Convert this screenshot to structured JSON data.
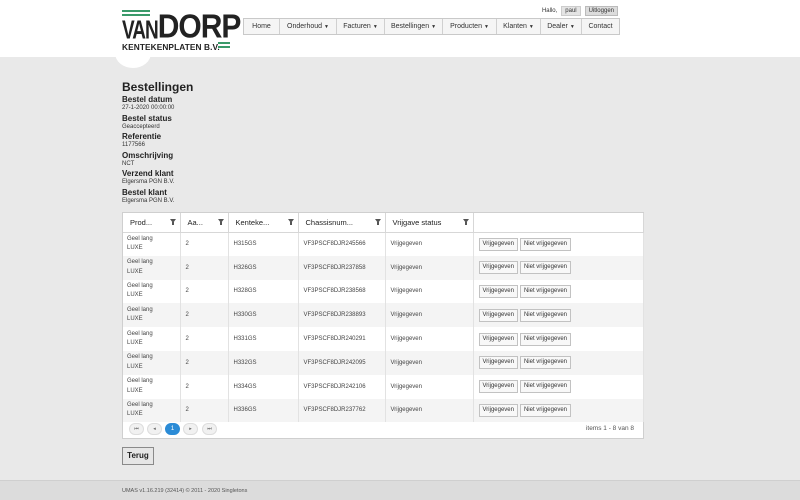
{
  "logo": {
    "top": "VAN DORP",
    "van": "VAN",
    "dorp": "DORP",
    "sub": "KENTEKENPLATEN B.V.",
    "accent": "#3a9a6a"
  },
  "user": {
    "greeting": "Hallo,",
    "name": "paul",
    "logout": "Uitloggen"
  },
  "nav": [
    {
      "label": "Home",
      "dropdown": false
    },
    {
      "label": "Onderhoud",
      "dropdown": true
    },
    {
      "label": "Facturen",
      "dropdown": true
    },
    {
      "label": "Bestellingen",
      "dropdown": true
    },
    {
      "label": "Producten",
      "dropdown": true
    },
    {
      "label": "Klanten",
      "dropdown": true
    },
    {
      "label": "Dealer",
      "dropdown": true
    },
    {
      "label": "Contact",
      "dropdown": false
    }
  ],
  "page": {
    "title": "Bestellingen"
  },
  "details": [
    {
      "label": "Bestel datum",
      "value": "27-1-2020 00:00:00"
    },
    {
      "label": "Bestel status",
      "value": "Geaccepteerd"
    },
    {
      "label": "Referentie",
      "value": "1177566"
    },
    {
      "label": "Omschrijving",
      "value": "NCT"
    },
    {
      "label": "Verzend klant",
      "value": "Elgersma PGN B.V."
    },
    {
      "label": "Bestel klant",
      "value": "Elgersma PGN B.V."
    }
  ],
  "grid": {
    "columns": [
      "Prod...",
      "Aa...",
      "Kenteke...",
      "Chassisnum...",
      "Vrijgave status"
    ],
    "release_label": "Vrijgegeven",
    "unrelease_label": "Niet vrijgegeven",
    "rows": [
      {
        "product": [
          "Geel lang",
          "LUXE"
        ],
        "amount": "2",
        "plate": "H315GS",
        "chassis": "VF3PSCF8DJR245566",
        "status": "Vrijgegeven"
      },
      {
        "product": [
          "Geel lang",
          "LUXE"
        ],
        "amount": "2",
        "plate": "H326GS",
        "chassis": "VF3PSCF8DJR237858",
        "status": "Vrijgegeven"
      },
      {
        "product": [
          "Geel lang",
          "LUXE"
        ],
        "amount": "2",
        "plate": "H328GS",
        "chassis": "VF3PSCF8DJR238568",
        "status": "Vrijgegeven"
      },
      {
        "product": [
          "Geel lang",
          "LUXE"
        ],
        "amount": "2",
        "plate": "H330GS",
        "chassis": "VF3PSCF8DJR238893",
        "status": "Vrijgegeven"
      },
      {
        "product": [
          "Geel lang",
          "LUXE"
        ],
        "amount": "2",
        "plate": "H331GS",
        "chassis": "VF3PSCF8DJR240291",
        "status": "Vrijgegeven"
      },
      {
        "product": [
          "Geel lang",
          "LUXE"
        ],
        "amount": "2",
        "plate": "H332GS",
        "chassis": "VF3PSCF8DJR242095",
        "status": "Vrijgegeven"
      },
      {
        "product": [
          "Geel lang",
          "LUXE"
        ],
        "amount": "2",
        "plate": "H334GS",
        "chassis": "VF3PSCF8DJR242106",
        "status": "Vrijgegeven"
      },
      {
        "product": [
          "Geel lang",
          "LUXE"
        ],
        "amount": "2",
        "plate": "H336GS",
        "chassis": "VF3PSCF8DJR237762",
        "status": "Vrijgegeven"
      }
    ]
  },
  "pager": {
    "first": "⏮",
    "prev": "◂",
    "page": "1",
    "next": "▸",
    "last": "⏭",
    "info": "items 1 - 8 van 8",
    "active_color": "#2b8bd6"
  },
  "back_label": "Terug",
  "footer": "UMAS v1.16.219 (32414) © 2011 - 2020 Singletons"
}
